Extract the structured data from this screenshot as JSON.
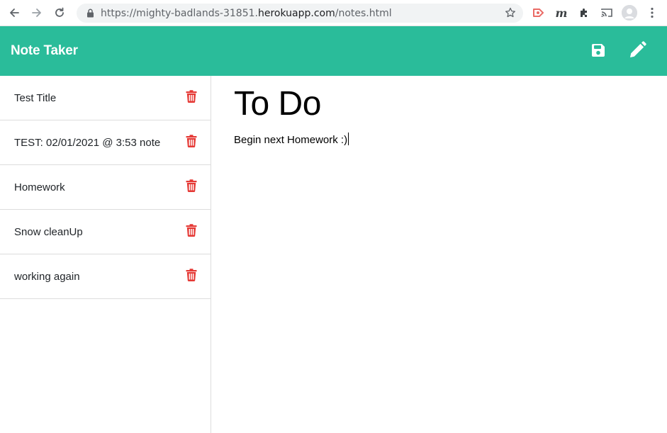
{
  "browser": {
    "url_prefix": "https://mighty-badlands-31851.",
    "url_host": "herokuapp.com",
    "url_path": "/notes.html",
    "icons": [
      "back-arrow-icon",
      "forward-arrow-icon",
      "reload-icon",
      "lock-icon",
      "star-icon",
      "extension-red-icon",
      "extension-m-icon",
      "puzzle-icon",
      "cast-icon",
      "profile-icon",
      "menu-dots-icon"
    ],
    "ext_m_label": "m"
  },
  "header": {
    "title": "Note Taker",
    "save_icon": "save-icon",
    "edit_icon": "pencil-icon",
    "background_color": "#2abc9a"
  },
  "notes": [
    {
      "title": "Test Title"
    },
    {
      "title": "TEST: 02/01/2021 @ 3:53 note"
    },
    {
      "title": "Homework"
    },
    {
      "title": "Snow cleanUp"
    },
    {
      "title": "working again"
    }
  ],
  "delete_icon_color": "#e53935",
  "active_note": {
    "title": "To Do",
    "text": "Begin next Homework :)"
  }
}
